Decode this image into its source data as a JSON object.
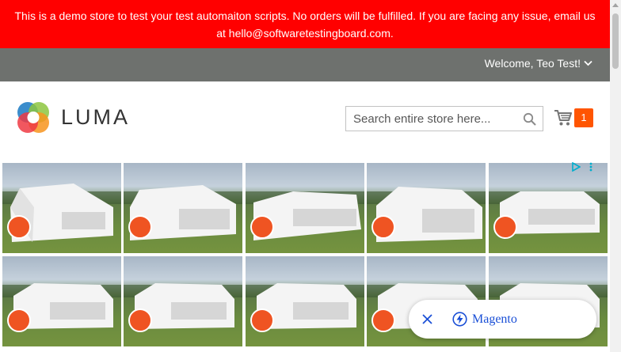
{
  "notice": {
    "text": "This is a demo store to test your test automaiton scripts. No orders will be fulfilled. If you are facing any issue, email us at hello@softwaretestingboard.com.",
    "color": "#ff0000"
  },
  "panel": {
    "welcome_text": "Welcome, Teo Test!",
    "dropdown_icon": "chevron-down-icon",
    "background": "#6e716e"
  },
  "header": {
    "logo_text": "LUMA",
    "search": {
      "placeholder": "Search entire store here...",
      "value": "",
      "icon": "search-icon"
    },
    "cart": {
      "icon": "cart-icon",
      "count": "1",
      "badge_color": "#ff5501"
    }
  },
  "ad": {
    "tile_count": 10,
    "icons": [
      "play-triangle-icon",
      "more-vertical-icon"
    ]
  },
  "toast": {
    "close_icon": "close-icon",
    "bolt_icon": "bolt-icon",
    "label": "Magento",
    "label_color": "#1a4fd6"
  }
}
